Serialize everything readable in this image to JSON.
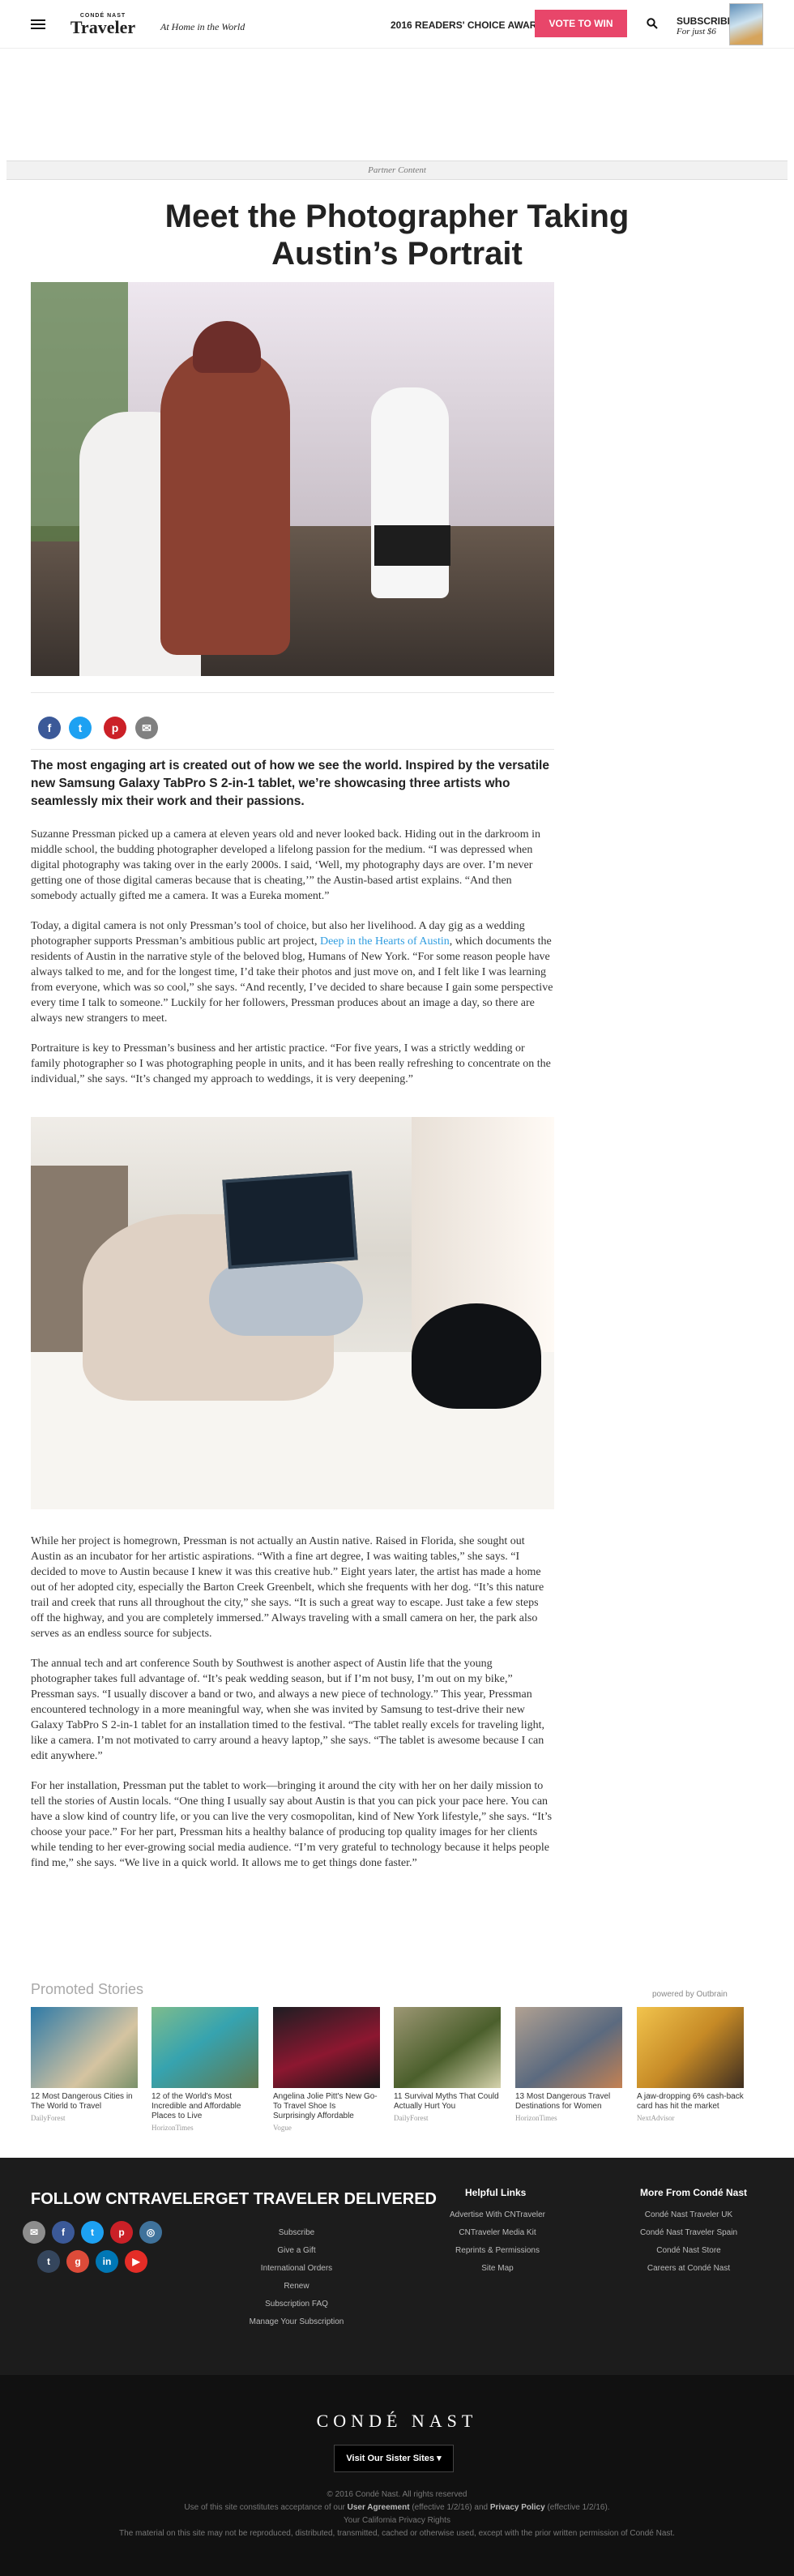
{
  "header": {
    "brand_small": "CONDÉ NAST",
    "brand_main": "Traveler",
    "tagline": "At Home in the World",
    "award": "2016 READERS' CHOICE AWARDS",
    "vote_label": "VOTE TO WIN",
    "subscribe_label": "SUBSCRIBE",
    "subscribe_price": "For just $6"
  },
  "partner_label": "Partner Content",
  "title": "Meet the Photographer Taking Austin’s Portrait",
  "lede": "The most engaging art is created out of how we see the world. Inspired by the versatile new Samsung Galaxy TabPro S 2-in-1 tablet, we’re showcasing three artists who seamlessly mix their work and their passions.",
  "paragraphs": [
    "Suzanne Pressman picked up a camera at eleven years old and never looked back. Hiding out in the darkroom in middle school, the budding photographer developed a lifelong passion for the medium. “I was depressed when digital photography was taking over in the early 2000s. I said, ‘Well, my photography days are over. I’m never getting one of those digital cameras because that is cheating,’” the Austin-based artist explains. “And then somebody actually gifted me a camera. It was a Eureka moment.”",
    "Today, a digital camera is not only Pressman’s tool of choice, but also her livelihood. A day gig as a wedding photographer supports Pressman’s ambitious public art project,",
    "Deep in the Hearts of Austin",
    ", which documents the residents of Austin in the narrative style of the beloved blog, Humans of New York. “For some reason people have always talked to me, and for the longest time, I’d take their photos and just move on, and I felt like I was learning from everyone, which was so cool,” she says. “And recently, I’ve decided to share because I gain some perspective every time I talk to someone.” Luckily for her followers, Pressman produces about an image a day, so there are always new strangers to meet.",
    "Portraiture is key to Pressman’s business and her artistic practice. “For five years, I was a strictly wedding or family photographer so I was photographing people in units, and it has been really refreshing to concentrate on the individual,” she says. “It’s changed my approach to weddings, it is very deepening.”",
    "While her project is homegrown, Pressman is not actually an Austin native. Raised in Florida, she sought out Austin as an incubator for her artistic aspirations. “With a fine art degree, I was waiting tables,” she says. “I decided to move to Austin because I knew it was this creative hub.” Eight years later, the artist has made a home out of her adopted city, especially the Barton Creek Greenbelt, which she frequents with her dog. “It’s this nature trail and creek that runs all throughout the city,” she says. “It is such a great way to escape. Just take a few steps off the highway, and you are completely immersed.” Always traveling with a small camera on her, the park also serves as an endless source for subjects.",
    "The annual tech and art conference South by Southwest is another aspect of Austin life that the young photographer takes full advantage of. “It’s peak wedding season, but if I’m not busy, I’m out on my bike,” Pressman says. “I usually discover a band or two, and always a new piece of technology.” This year, Pressman encountered technology in a more meaningful way, when she was invited by Samsung to test-drive their new Galaxy TabPro S 2-in-1 tablet for an installation timed to the festival. “The tablet really excels for traveling light, like a camera. I’m not motivated to carry around a heavy laptop,” she says. “The tablet is awesome because I can edit anywhere.”",
    "For her installation, Pressman put the tablet to work—bringing it around the city with her on her daily mission to tell the stories of Austin locals. “One thing I usually say about Austin is that you can pick your pace here. You can have a slow kind of country life, or you can live the very cosmopolitan, kind of New York lifestyle,” she says. “It’s choose your pace.” For her part, Pressman hits a healthy balance of producing top quality images for her clients while tending to her ever-growing social media audience. “I’m very grateful to technology because it helps people find me,” she says. “We live in a quick world. It allows me to get things done faster.”"
  ],
  "share": [
    "f",
    "t",
    "p",
    "✉"
  ],
  "promoted": {
    "title": "Promoted Stories",
    "powered": "powered by Outbrain",
    "items": [
      {
        "title": "12 Most Dangerous Cities in The World to Travel",
        "source": "DailyForest"
      },
      {
        "title": "12 of the World's Most Incredible and Affordable Places to Live",
        "source": "HorizonTimes"
      },
      {
        "title": "Angelina Jolie Pitt's New Go-To Travel Shoe Is Surprisingly Affordable",
        "source": "Vogue"
      },
      {
        "title": "11 Survival Myths That Could Actually Hurt You",
        "source": "DailyForest"
      },
      {
        "title": "13 Most Dangerous Travel Destinations for Women",
        "source": "HorizonTimes"
      },
      {
        "title": "A jaw-dropping 6% cash-back card has hit the market",
        "source": "NextAdvisor"
      }
    ]
  },
  "footer": {
    "follow": "FOLLOW CNTRAVELER",
    "delivered": "GET TRAVELER DELIVERED",
    "delivered_links": [
      "Subscribe",
      "Give a Gift",
      "International Orders",
      "Renew",
      "Subscription FAQ",
      "Manage Your Subscription"
    ],
    "helpful_title": "Helpful Links",
    "helpful_links": [
      "Advertise With CNTraveler",
      "CNTraveler Media Kit",
      "Reprints & Permissions",
      "Site Map"
    ],
    "more_title": "More From Condé Nast",
    "more_links": [
      "Condé Nast Traveler UK",
      "Condé Nast Traveler Spain",
      "Condé Nast Store",
      "Careers at Condé Nast"
    ],
    "brand": "CONDÉ NAST",
    "sister": "Visit Our Sister Sites ▾",
    "legal_1": "© 2016 Condé Nast. All rights reserved",
    "legal_2": "Use of this site constitutes acceptance of our",
    "legal_ua": "User Agreement",
    "legal_3": "(effective 1/2/16) and",
    "legal_pp": "Privacy Policy",
    "legal_4": "(effective 1/2/16).",
    "legal_ca": "Your California Privacy Rights",
    "legal_5": "The material on this site may not be reproduced, distributed, transmitted, cached or otherwise used, except with the prior written permission of Condé Nast."
  },
  "colors": {
    "vote": "#e8466a",
    "facebook": "#3b5998",
    "twitter": "#1da1f2",
    "pinterest": "#cb2027"
  }
}
